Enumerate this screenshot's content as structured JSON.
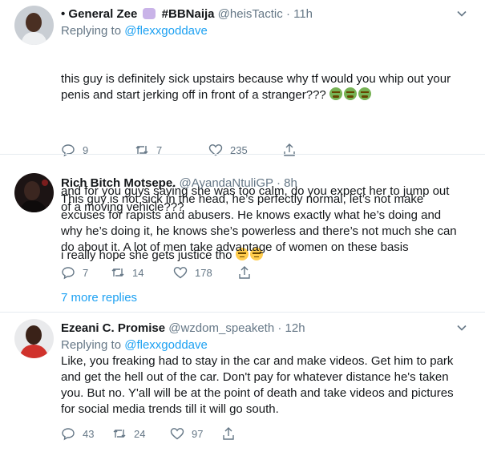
{
  "tweets": [
    {
      "name": "• General Zee",
      "hashtag": "#BBNaija",
      "handle": "@heisTactic",
      "time": "11h",
      "reply_label": "Replying to",
      "reply_to": "@flexxgoddave",
      "text_p1": "this guy is definitely sick upstairs because why tf would you whip out your penis and start jerking off in front of a stranger???",
      "text_p2": "and for you guys saying she was too calm, do you expect her to jump out of a moving vehicle???",
      "text_p3": "i really hope she gets justice tho",
      "replies": "9",
      "retweets": "7",
      "likes": "235"
    },
    {
      "name": "Rich Bitch Motsepe.",
      "handle": "@AyandaNtuliGP",
      "time": "8h",
      "text": "This guy is not sick in the head, he’s perfectly normal, let’s not make excuses for rapists and abusers. He knows exactly what he’s doing and why he’s doing it, he knows she’s powerless and there’s not much she can do about it. A lot of men take advantage of women on these basis",
      "replies": "7",
      "retweets": "14",
      "likes": "178"
    },
    {
      "name": "Ezeani C. Promise",
      "handle": "@wzdom_speaketh",
      "time": "12h",
      "reply_label": "Replying to",
      "reply_to": "@flexxgoddave",
      "text": "Like, you freaking had to stay in the car and make videos. Get him to park and get the hell out of the car. Don't pay for whatever distance he's taken you. But no. Y'all will be at the point of death and take videos and pictures for social media trends till it will go south.",
      "replies": "43",
      "retweets": "24",
      "likes": "97"
    }
  ],
  "more_replies": "7 more replies",
  "icons": [
    "chevron-down-icon",
    "reply-icon",
    "retweet-icon",
    "like-icon",
    "share-icon",
    "nauseated-face-emoji",
    "expressionless-face-emoji",
    "mask-emoji"
  ],
  "colors": {
    "accent": "#1da1f2",
    "muted": "#657786",
    "text": "#14171a",
    "divider": "#e6ecf0"
  }
}
